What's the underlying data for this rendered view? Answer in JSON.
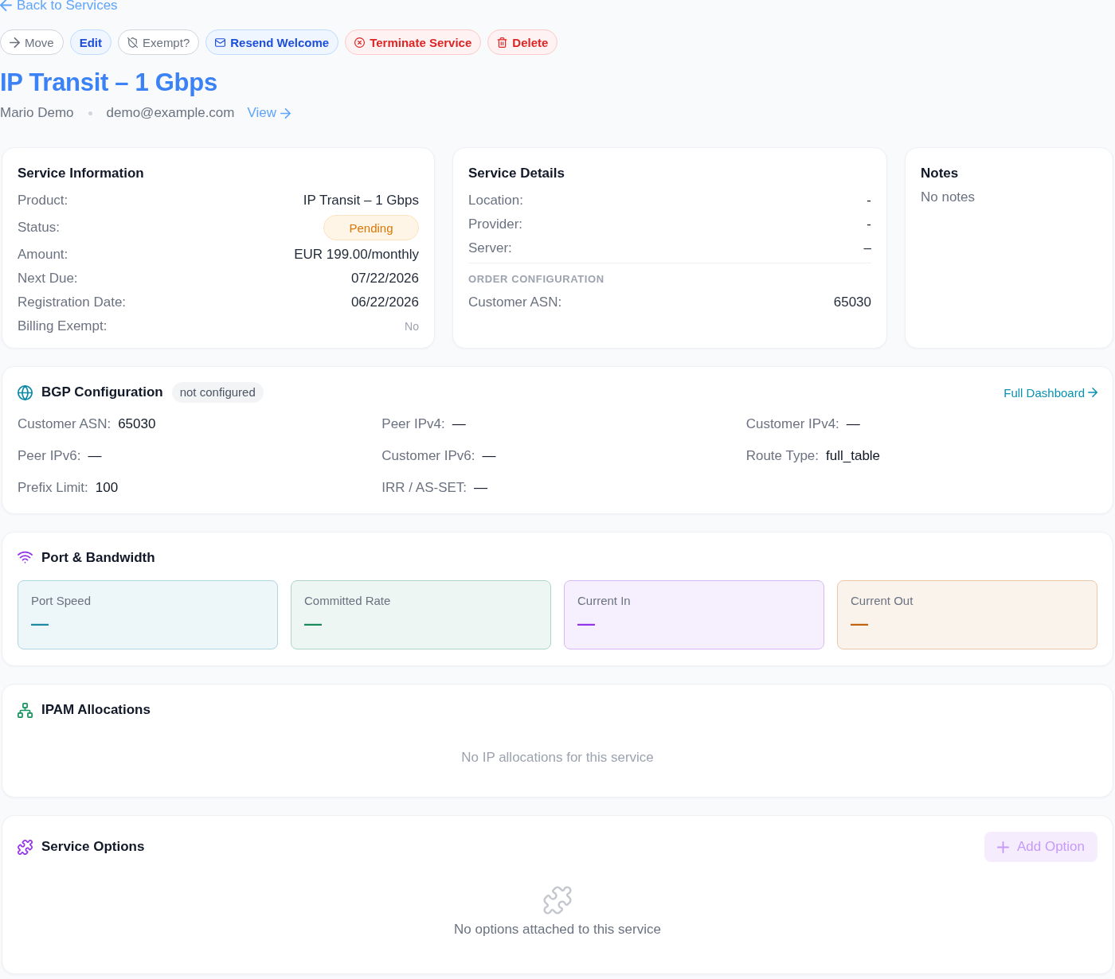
{
  "back_link": {
    "label": "Back to Services"
  },
  "actions": [
    {
      "label": "Move",
      "kind": "move"
    },
    {
      "label": "Edit",
      "kind": "edit"
    },
    {
      "label": "Exempt?",
      "kind": "exempt"
    },
    {
      "label": "Resend Welcome",
      "kind": "resend"
    },
    {
      "label": "Terminate Service",
      "kind": "terminate"
    },
    {
      "label": "Delete",
      "kind": "delete"
    }
  ],
  "title": "IP Transit – 1 Gbps",
  "customer": {
    "name": "Mario Demo",
    "email": "demo@example.com",
    "link": "View"
  },
  "service_information": {
    "title": "Service Information",
    "rows": [
      {
        "label": "Product:",
        "value": "IP Transit – 1 Gbps",
        "kind": "text"
      },
      {
        "label": "Status:",
        "value": "Pending",
        "kind": "badge"
      },
      {
        "label": "Amount:",
        "value": "EUR 199.00/monthly",
        "kind": "text"
      },
      {
        "label": "Next Due:",
        "value": "07/22/2026",
        "kind": "text"
      },
      {
        "label": "Registration Date:",
        "value": "06/22/2026",
        "kind": "text"
      },
      {
        "label": "Billing Exempt:",
        "value": "No",
        "kind": "muted"
      }
    ]
  },
  "service_details": {
    "title": "Service Details",
    "rows": [
      {
        "label": "Location:",
        "value": "-"
      },
      {
        "label": "Provider:",
        "value": "-"
      },
      {
        "label": "Server:",
        "value": "–"
      }
    ],
    "section": "ORDER CONFIGURATION",
    "config_rows": [
      {
        "label": "Customer ASN:",
        "value": "65030"
      }
    ]
  },
  "notes": {
    "title": "Notes",
    "text": "No notes"
  },
  "bgp": {
    "title": "BGP Configuration",
    "badge": "not configured",
    "link": "Full Dashboard",
    "fields": [
      {
        "label": "Customer ASN:",
        "value": "65030"
      },
      {
        "label": "Peer IPv4:",
        "value": "—"
      },
      {
        "label": "Customer IPv4:",
        "value": "—"
      },
      {
        "label": "Peer IPv6:",
        "value": "—"
      },
      {
        "label": "Customer IPv6:",
        "value": "—"
      },
      {
        "label": "Route Type:",
        "value": "full_table"
      },
      {
        "label": "Prefix Limit:",
        "value": "100"
      },
      {
        "label": "IRR / AS-SET:",
        "value": "—"
      }
    ]
  },
  "bandwidth": {
    "title": "Port & Bandwidth",
    "tiles": [
      {
        "label": "Port Speed",
        "value": "—",
        "color": "#1d8aa5"
      },
      {
        "label": "Committed Rate",
        "value": "—",
        "color": "#1a8a5a"
      },
      {
        "label": "Current In",
        "value": "—",
        "color": "#9333ea"
      },
      {
        "label": "Current Out",
        "value": "—",
        "color": "#c2630f"
      }
    ]
  },
  "ipam": {
    "title": "IPAM Allocations",
    "empty": "No IP allocations for this service"
  },
  "service_options": {
    "title": "Service Options",
    "add_button": {
      "label": "Add Option",
      "disabled": true
    },
    "empty": "No options attached to this service"
  }
}
